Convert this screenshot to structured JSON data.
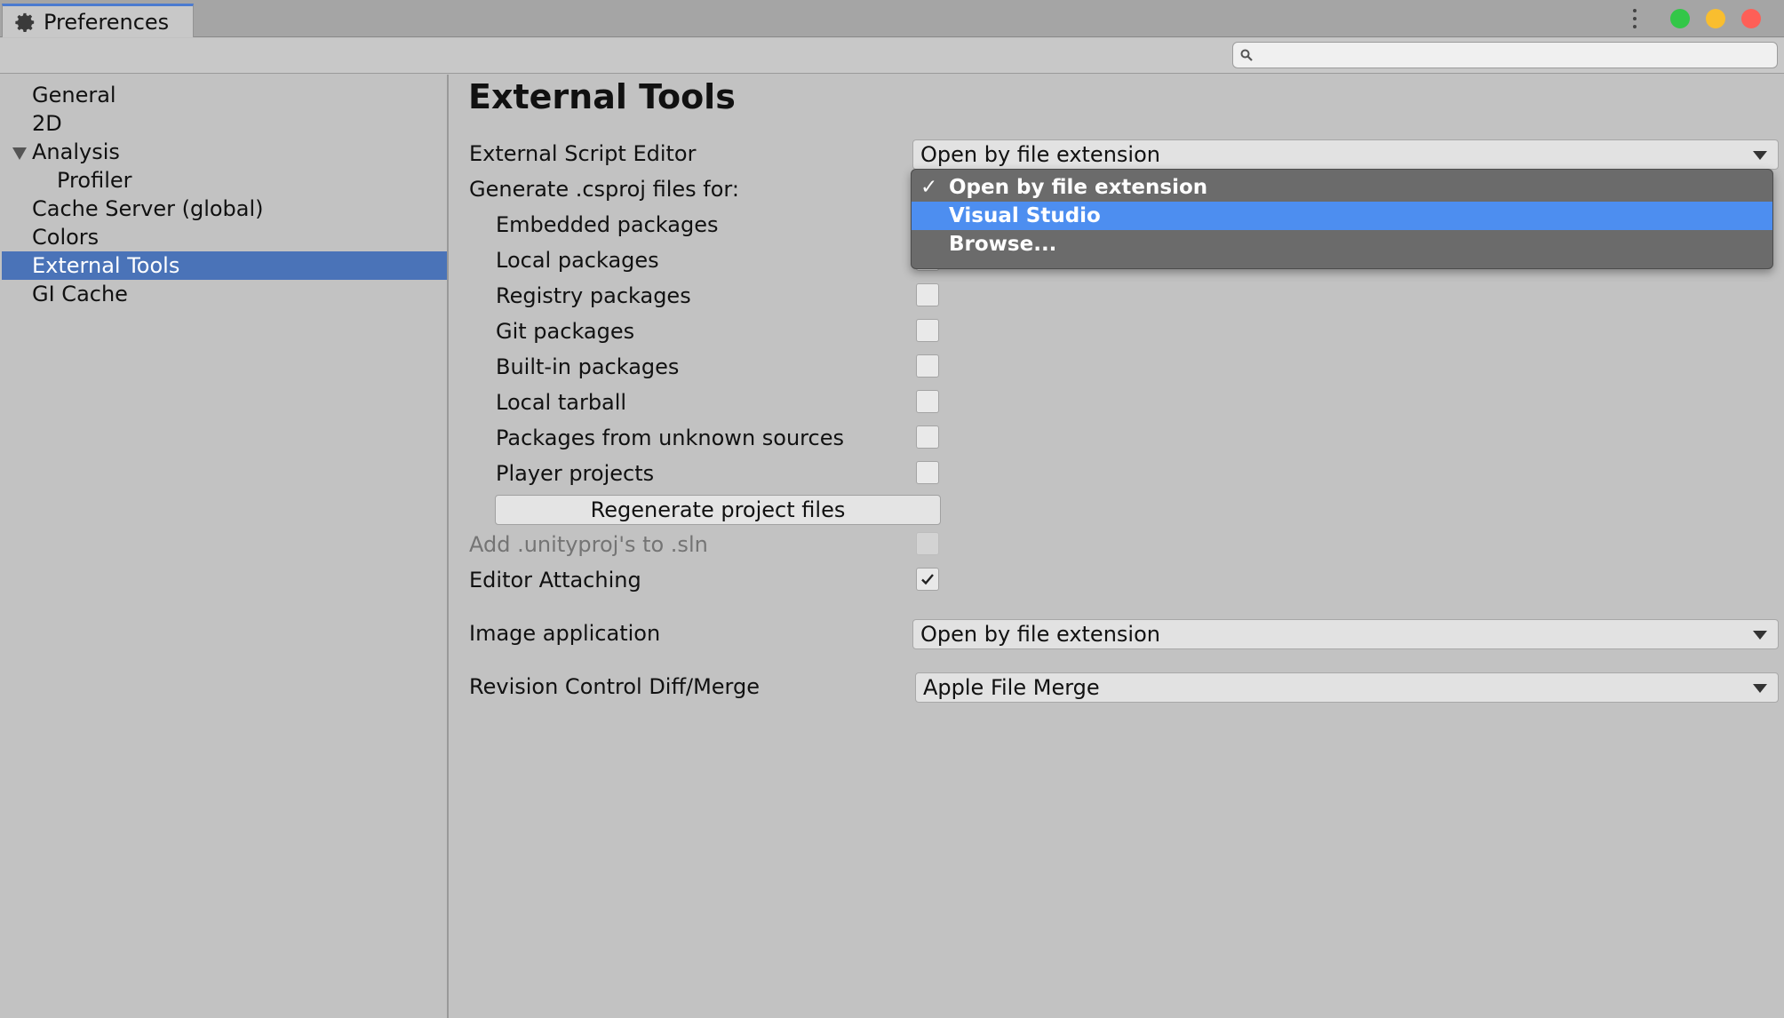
{
  "window": {
    "tab_label": "Preferences",
    "traffic_lights": [
      "#33c748",
      "#f9be2f",
      "#fe5f57"
    ]
  },
  "search": {
    "placeholder": "",
    "value": ""
  },
  "sidebar": {
    "items": [
      {
        "label": "General",
        "selected": false
      },
      {
        "label": "2D",
        "selected": false
      },
      {
        "label": "Analysis",
        "selected": false,
        "expanded": true
      },
      {
        "label": "Profiler",
        "selected": false,
        "child": true
      },
      {
        "label": "Cache Server (global)",
        "selected": false
      },
      {
        "label": "Colors",
        "selected": false
      },
      {
        "label": "External Tools",
        "selected": true
      },
      {
        "label": "GI Cache",
        "selected": false
      }
    ]
  },
  "main": {
    "title": "External Tools",
    "script_editor": {
      "label": "External Script Editor",
      "value": "Open by file extension"
    },
    "generate_label": "Generate .csproj files for:",
    "packages": [
      {
        "label": "Embedded packages",
        "checked": false
      },
      {
        "label": "Local packages",
        "checked": false
      },
      {
        "label": "Registry packages",
        "checked": false
      },
      {
        "label": "Git packages",
        "checked": false
      },
      {
        "label": "Built-in packages",
        "checked": false
      },
      {
        "label": "Local tarball",
        "checked": false
      },
      {
        "label": "Packages from unknown sources",
        "checked": false
      },
      {
        "label": "Player projects",
        "checked": false
      }
    ],
    "regenerate_button": "Regenerate project files",
    "add_unityproj": {
      "label": "Add .unityproj's to .sln",
      "checked": false,
      "disabled": true
    },
    "editor_attaching": {
      "label": "Editor Attaching",
      "checked": true
    },
    "image_application": {
      "label": "Image application",
      "value": "Open by file extension"
    },
    "revision_control": {
      "label": "Revision Control Diff/Merge",
      "value": "Apple File Merge"
    }
  },
  "editor_menu": {
    "check_mark": "✓",
    "items": [
      {
        "label": "Open by file extension",
        "checked": true,
        "highlighted": false
      },
      {
        "label": "Visual Studio",
        "checked": false,
        "highlighted": true
      },
      {
        "label": "Browse...",
        "checked": false,
        "highlighted": false
      }
    ]
  },
  "colors": {
    "accent_selection": "#4a73b8",
    "menu_highlight": "#4d8ef0",
    "panel_bg": "#c2c2c2"
  }
}
